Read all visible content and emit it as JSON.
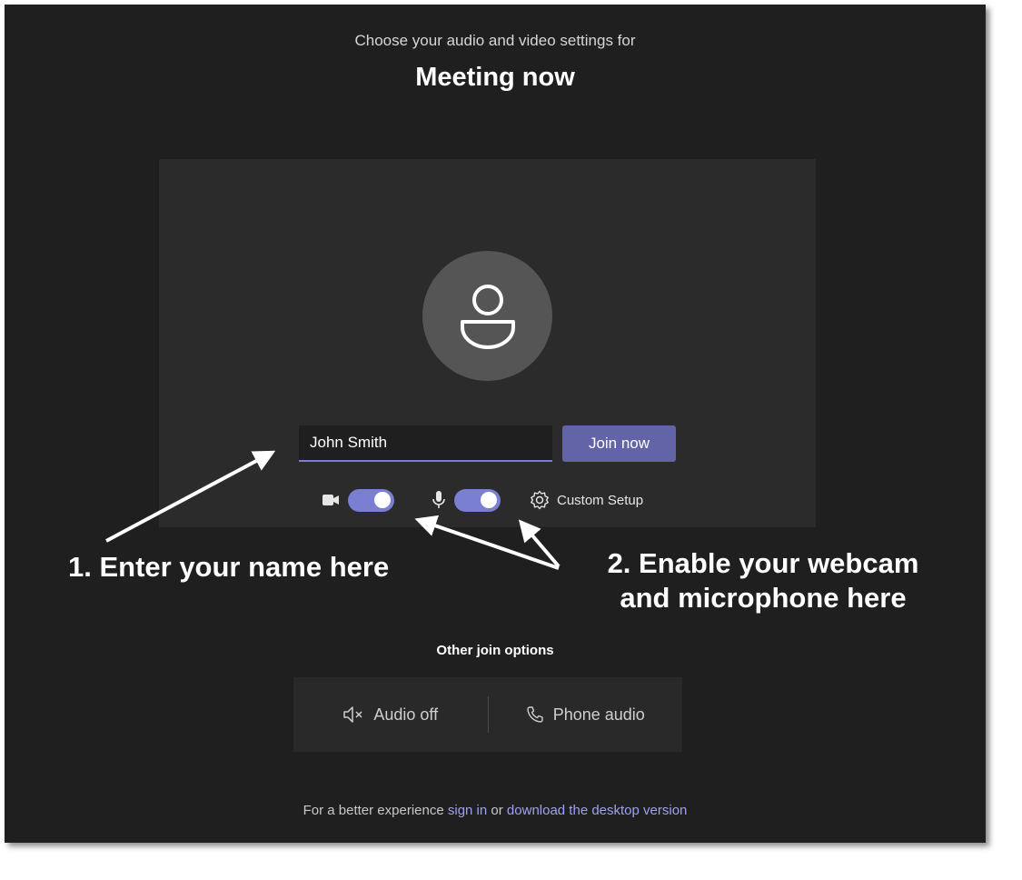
{
  "header": {
    "subtitle": "Choose your audio and video settings for",
    "title": "Meeting now"
  },
  "preview": {
    "avatar_icon": "person-icon",
    "name_value": "John Smith",
    "join_label": "Join now",
    "camera_icon": "video-camera-icon",
    "camera_toggle_on": true,
    "mic_icon": "microphone-icon",
    "mic_toggle_on": true,
    "settings_icon": "gear-icon",
    "custom_setup_label": "Custom Setup"
  },
  "annotations": {
    "step1": "1. Enter your name here",
    "step2_line1": "2. Enable your webcam",
    "step2_line2": "and microphone here"
  },
  "other_options": {
    "label": "Other join options",
    "audio_off_label": "Audio off",
    "audio_off_icon": "speaker-muted-icon",
    "phone_audio_label": "Phone audio",
    "phone_audio_icon": "phone-icon"
  },
  "footer": {
    "prefix": "For a better experience ",
    "sign_in": "sign in",
    "middle": " or ",
    "download": "download the desktop version"
  },
  "colors": {
    "background": "#1f1f1f",
    "panel": "#2b2b2b",
    "accent": "#6264a7",
    "toggle": "#7b7fd1",
    "link": "#9ea2f0"
  }
}
